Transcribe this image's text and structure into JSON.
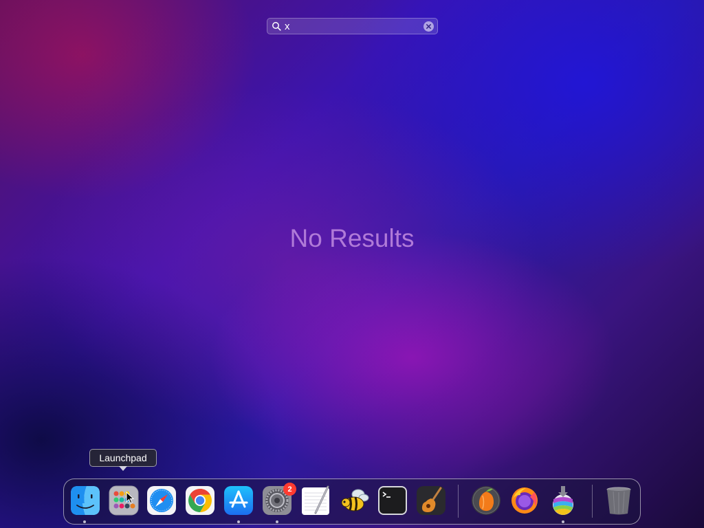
{
  "search": {
    "value": "x",
    "placeholder": "Search"
  },
  "message": "No Results",
  "tooltip": "Launchpad",
  "dock": {
    "apps": [
      {
        "name": "Finder",
        "icon": "finder-icon",
        "running": true
      },
      {
        "name": "Launchpad",
        "icon": "launchpad-icon",
        "running": false
      },
      {
        "name": "Safari",
        "icon": "safari-icon",
        "running": false
      },
      {
        "name": "Google Chrome",
        "icon": "chrome-icon",
        "running": false
      },
      {
        "name": "App Store",
        "icon": "app-store-icon",
        "running": true
      },
      {
        "name": "System Settings",
        "icon": "system-settings-icon",
        "running": true,
        "badge": "2"
      },
      {
        "name": "TextEdit",
        "icon": "textedit-icon",
        "running": false
      },
      {
        "name": "Bee",
        "icon": "bee-icon",
        "running": false
      },
      {
        "name": "Terminal",
        "icon": "terminal-icon",
        "running": false
      },
      {
        "name": "GarageBand",
        "icon": "garageband-icon",
        "running": false
      },
      {
        "name": "FL Studio",
        "icon": "fl-studio-icon",
        "running": false
      },
      {
        "name": "Firefox",
        "icon": "firefox-icon",
        "running": false
      },
      {
        "name": "Installer",
        "icon": "installer-icon",
        "running": true
      },
      {
        "name": "Trash",
        "icon": "trash-icon",
        "running": false
      }
    ]
  }
}
